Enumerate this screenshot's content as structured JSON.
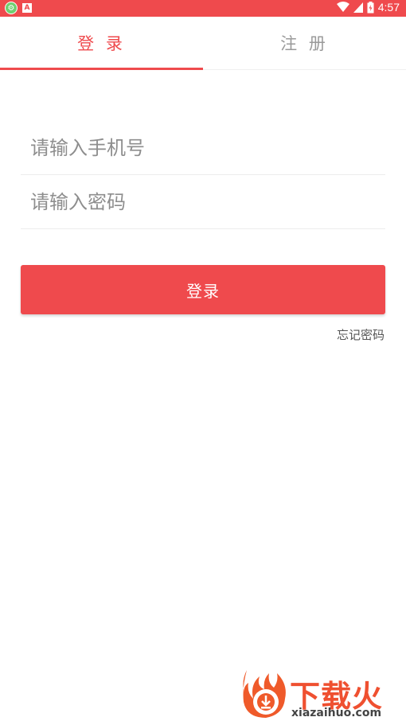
{
  "status_bar": {
    "time": "4:57",
    "icons": [
      "app-notification-icon",
      "a-notification-icon",
      "wifi-icon",
      "signal-icon",
      "battery-icon"
    ]
  },
  "tabs": {
    "login_label": "登 录",
    "register_label": "注 册",
    "active": "login"
  },
  "form": {
    "phone_placeholder": "请输入手机号",
    "phone_value": "",
    "password_placeholder": "请输入密码",
    "password_value": ""
  },
  "login_button": "登录",
  "forgot_password": "忘记密码",
  "watermark": {
    "brand": "下载火",
    "domain": "xiazaihuo.com"
  },
  "colors": {
    "accent": "#ef4a4d",
    "inactive_tab": "#9a9a9a",
    "placeholder": "#8e8e8e"
  }
}
